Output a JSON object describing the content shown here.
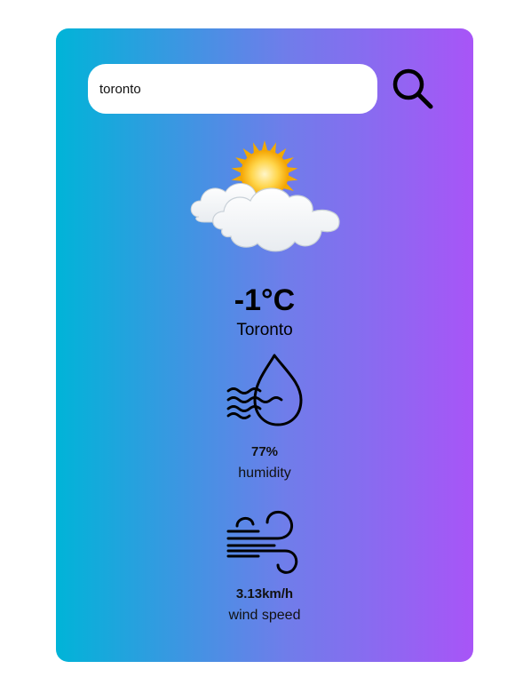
{
  "search": {
    "value": "toronto",
    "icon": "search-icon"
  },
  "weather": {
    "condition_icon": "partly-cloudy-icon",
    "temperature": "-1°C",
    "city": "Toronto"
  },
  "details": {
    "humidity": {
      "icon": "humidity-icon",
      "value": "77%",
      "label": "humidity"
    },
    "wind": {
      "icon": "wind-icon",
      "value": "3.13km/h",
      "label": "wind speed"
    }
  },
  "colors": {
    "gradient_start": "#00b4d8",
    "gradient_end": "#a855f7",
    "text": "#000000"
  }
}
